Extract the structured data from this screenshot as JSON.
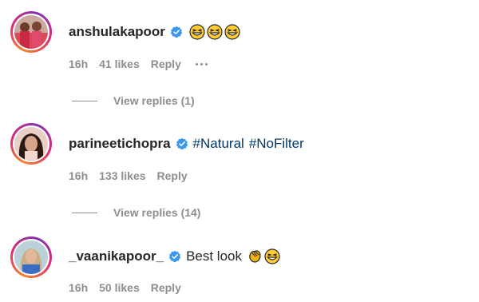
{
  "comments": [
    {
      "username": "anshulakapoor",
      "text": "",
      "hashtags": [],
      "emojis": [
        "grinning-squint-face",
        "grinning-squint-face",
        "grinning-squint-face"
      ],
      "time": "16h",
      "likes": "41 likes",
      "reply_label": "Reply",
      "more_options": true,
      "view_replies": "View replies (1)"
    },
    {
      "username": "parineetichopra",
      "text": "",
      "hashtags": [
        "#Natural",
        "#NoFilter"
      ],
      "emojis": [],
      "time": "16h",
      "likes": "133 likes",
      "reply_label": "Reply",
      "more_options": false,
      "view_replies": "View replies (14)"
    },
    {
      "username": "_vaanikapoor_",
      "text": "Best look",
      "hashtags": [],
      "emojis": [
        "clapping-hands",
        "grinning-squint-face"
      ],
      "time": "16h",
      "likes": "50 likes",
      "reply_label": "Reply",
      "more_options": false,
      "view_replies": ""
    }
  ],
  "colors": {
    "hashtag": "#00376b",
    "verified": "#3897f0",
    "meta": "#8e8e8e",
    "username": "#262626"
  }
}
